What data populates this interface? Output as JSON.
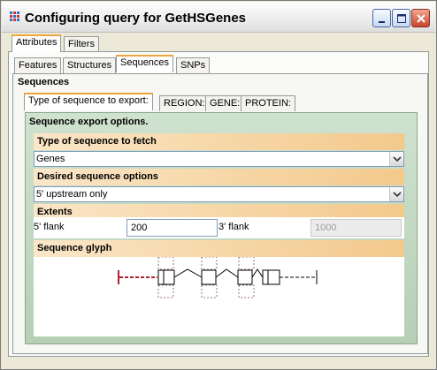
{
  "window": {
    "title": "Configuring query for GetHSGenes"
  },
  "top_tabs": [
    {
      "label": "Attributes",
      "active": true
    },
    {
      "label": "Filters",
      "active": false
    }
  ],
  "attribute_tabs": [
    {
      "label": "Features",
      "active": false
    },
    {
      "label": "Structures",
      "active": false
    },
    {
      "label": "Sequences",
      "active": true
    },
    {
      "label": "SNPs",
      "active": false
    }
  ],
  "sequences": {
    "heading": "Sequences",
    "sub_tabs": [
      {
        "label": "Type of sequence to export:",
        "active": true
      },
      {
        "label": "REGION:",
        "active": false
      },
      {
        "label": "GENE:",
        "active": false
      },
      {
        "label": "PROTEIN:",
        "active": false
      }
    ],
    "export_options_title": "Sequence export options.",
    "type_section": {
      "header": "Type of sequence to fetch",
      "selected": "Genes"
    },
    "options_section": {
      "header": "Desired sequence options",
      "selected": "5' upstream only"
    },
    "extents_section": {
      "header": "Extents",
      "five_prime_label": "5' flank",
      "five_prime_value": "200",
      "three_prime_label": "3' flank",
      "three_prime_value": "1000"
    },
    "glyph_section": {
      "header": "Sequence glyph",
      "highlight_color": "#b22230"
    }
  },
  "icons": {
    "app": "grid-dots-icon",
    "minimize": "minimize-icon",
    "maximize": "maximize-icon",
    "close": "close-icon",
    "dropdown": "chevron-down-icon"
  }
}
